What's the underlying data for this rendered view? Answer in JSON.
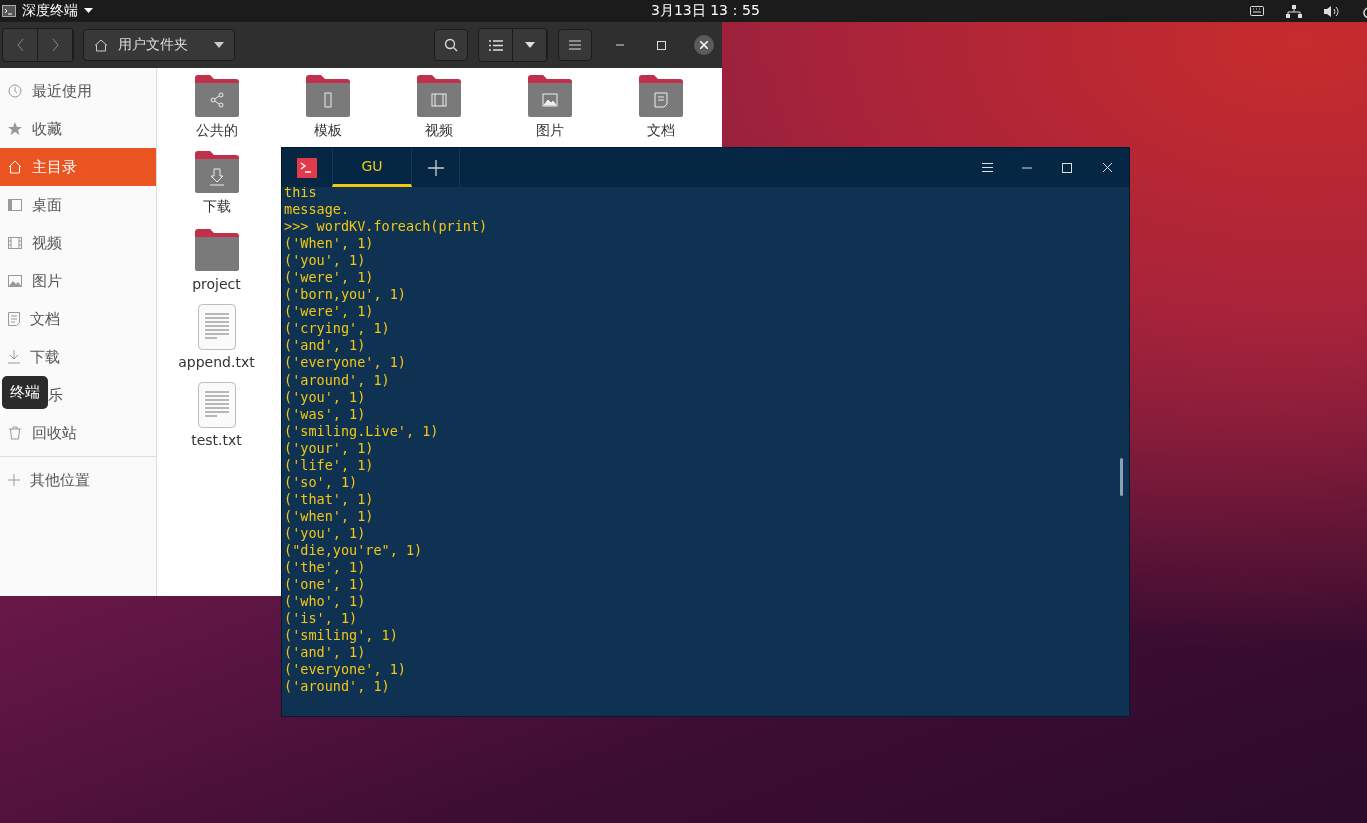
{
  "top_bar": {
    "app_menu": "深度终端",
    "clock": "3月13日 13：55"
  },
  "file_manager": {
    "location": "用户文件夹",
    "sidebar": [
      {
        "label": "最近使用",
        "selected": false
      },
      {
        "label": "收藏",
        "selected": false
      },
      {
        "label": "主目录",
        "selected": true
      },
      {
        "label": "桌面",
        "selected": false
      },
      {
        "label": "视频",
        "selected": false
      },
      {
        "label": "图片",
        "selected": false
      },
      {
        "label": "文档",
        "selected": false
      },
      {
        "label": "下载",
        "selected": false
      },
      {
        "label": "乐",
        "selected": false
      },
      {
        "label": "回收站",
        "selected": false
      }
    ],
    "other_locations": "其他位置",
    "top_row": [
      {
        "name": "公共的",
        "kind": "folder"
      },
      {
        "name": "模板",
        "kind": "folder"
      },
      {
        "name": "视频",
        "kind": "folder"
      },
      {
        "name": "图片",
        "kind": "folder"
      },
      {
        "name": "文档",
        "kind": "folder"
      }
    ],
    "first_column": [
      {
        "name": "下载",
        "kind": "folder"
      },
      {
        "name": "project",
        "kind": "folder"
      },
      {
        "name": "append.txt",
        "kind": "document"
      },
      {
        "name": "test.txt",
        "kind": "document"
      }
    ],
    "tooltip": "终端"
  },
  "terminal": {
    "tabs": [
      {
        "label": "GU",
        "selected": true
      }
    ],
    "lines": [
      "this",
      "message.",
      ">>> wordKV.foreach(print)",
      "('When', 1)",
      "('you', 1)",
      "('were', 1)",
      "('born,you', 1)",
      "('were', 1)",
      "('crying', 1)",
      "('and', 1)",
      "('everyone', 1)",
      "('around', 1)",
      "('you', 1)",
      "('was', 1)",
      "('smiling.Live', 1)",
      "('your', 1)",
      "('life', 1)",
      "('so', 1)",
      "('that', 1)",
      "('when', 1)",
      "('you', 1)",
      "(\"die,you're\", 1)",
      "('the', 1)",
      "('one', 1)",
      "('who', 1)",
      "('is', 1)",
      "('smiling', 1)",
      "('and', 1)",
      "('everyone', 1)",
      "('around', 1)"
    ]
  }
}
